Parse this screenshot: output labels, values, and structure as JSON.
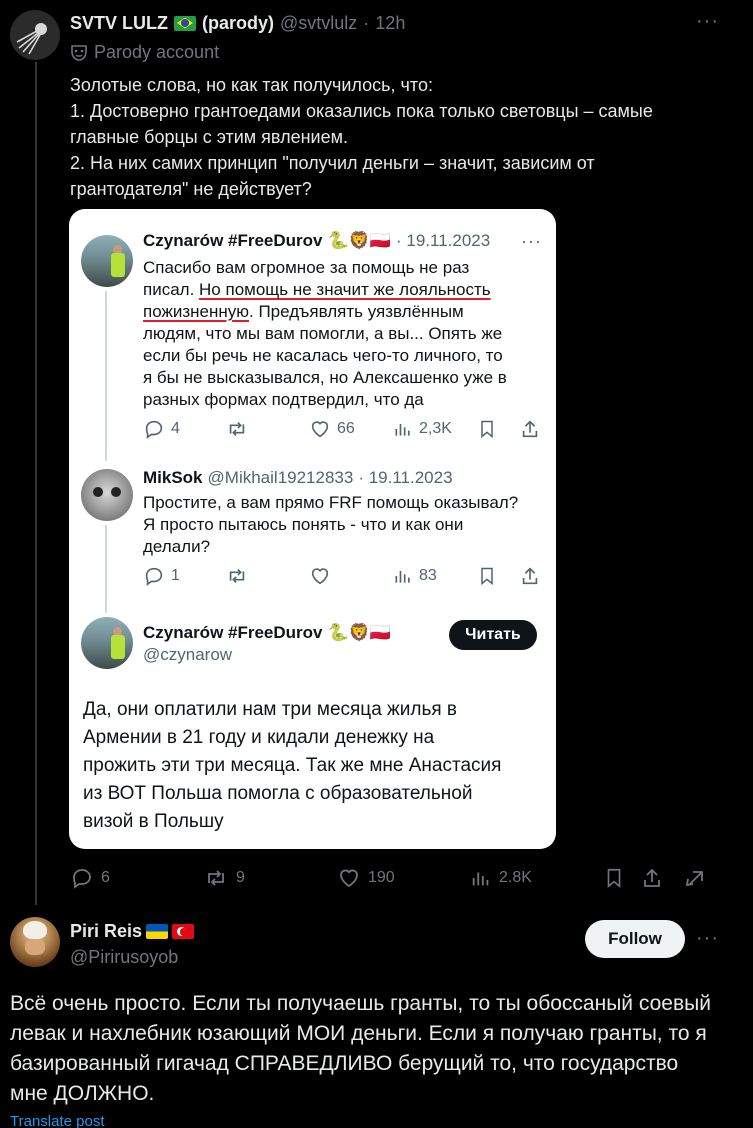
{
  "post": {
    "author_name": "SVTV LULZ",
    "author_suffix": "(parody)",
    "handle": "@svtvlulz",
    "separator": "·",
    "time": "12h",
    "more": "···",
    "parody_label": "Parody account",
    "body_lines": [
      "Золотые слова, но как так получилось, что:",
      "1. Достоверно грантоедами оказались пока только световцы – самые",
      "главные борцы с этим явлением.",
      "2. На них самих принцип \"получил деньги – значит, зависим от",
      "грантодателя\" не действует?"
    ],
    "actions": {
      "replies": "6",
      "reposts": "9",
      "likes": "190",
      "views": "2.8K"
    }
  },
  "embedded": {
    "tweet1": {
      "name": "Czynarów #FreeDurov",
      "emojis": "🐍🦁🇵🇱",
      "date": "· 19.11.2023",
      "more": "···",
      "line1": "Спасибо вам огромное за помощь не раз",
      "line2_plain": "писал. ",
      "line2_underlined": "Но помощь не значит же лояльность",
      "line3_underlined": "пожизненную",
      "line3_plain": ". Предъявлять уязвлённым",
      "line4": "людям, что мы вам помогли, а вы... Опять же",
      "line5": "если бы речь не касалась чего-то личного, то",
      "line6": "я бы не высказывался, но Алексашенко уже в",
      "line7": "разных формах подтвердил, что да",
      "replies": "4",
      "likes": "66",
      "views": "2,3K"
    },
    "tweet2": {
      "name": "MikSok",
      "handle": "@Mikhail19212833",
      "date": "· 19.11.2023",
      "line1": "Простите, а вам прямо FRF помощь оказывал?",
      "line2": "Я просто пытаюсь понять - что и как они",
      "line3": "делали?",
      "replies": "1",
      "views": "83"
    },
    "tweet3": {
      "name": "Czynarów #FreeDurov",
      "emojis": "🐍🦁🇵🇱",
      "handle": "@czynarow",
      "read_button": "Читать",
      "lines": [
        "Да, они оплатили нам три месяца жилья в",
        "Армении в 21 году и кидали денежку на",
        "прожить эти три месяца. Так же мне Анастасия",
        "из ВОТ Польша помогла с образовательной",
        "визой в Польшу"
      ]
    }
  },
  "reply": {
    "author_name": "Piri Reis",
    "handle": "@Pirirusoyob",
    "follow_label": "Follow",
    "more": "···",
    "body_lines": [
      "Всё очень просто. Если ты получаешь гранты, то ты обоссаный соевый",
      "левак и нахлебник юзающий МОИ деньги. Если я получаю гранты, то я",
      "базированный гигачад СПРАВЕДЛИВО берущий то, что государство",
      "мне ДОЛЖНО."
    ],
    "translate_label": "Translate post"
  },
  "colors": {
    "background": "#000000",
    "text": "#e7e9ea",
    "muted": "#71767b",
    "link": "#1d9bf0",
    "underline_red": "#e11d2e"
  }
}
